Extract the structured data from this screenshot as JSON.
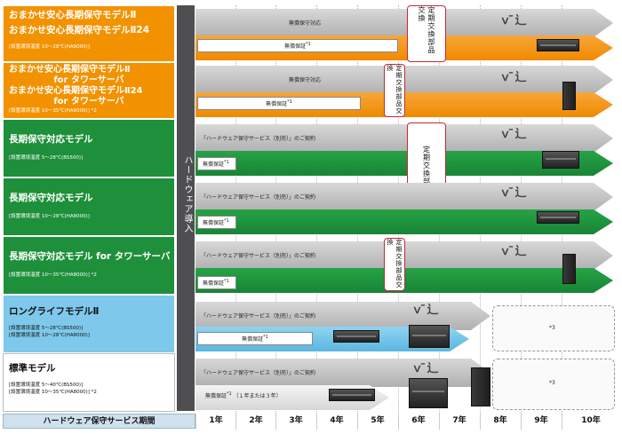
{
  "rows": [
    {
      "title": [
        "おまかせ安心長期保守モデルⅡ",
        "おまかせ安心長期保守モデルⅡ24"
      ],
      "sub": "[設置環境温度 10～28℃(HA8000)]",
      "top_text": "無償保守対応",
      "bottom_text": "無償保証",
      "sup": "*1",
      "end_label": "定期交換部品交換"
    },
    {
      "title": [
        "おまかせ安心長期保守モデルⅡ",
        "for タワーサーバ",
        "おまかせ安心長期保守モデルⅡ24",
        "for タワーサーバ"
      ],
      "sub": "[設置環境温度 10～35℃(HA8000)]",
      "sub_sup": "*2",
      "top_text": "無償保守対応",
      "bottom_text": "無償保証",
      "sup": "*1",
      "end_label": "定期交換部品交換"
    },
    {
      "title": [
        "長期保守対応モデル"
      ],
      "sub": "[設置環境温度 5～28℃(BS500)]",
      "top_text": "「ハードウェア保守サービス（別売）」のご契約",
      "bottom_text": "無償保証",
      "sup": "*1",
      "end_label": "定期交換部品交換"
    },
    {
      "title": [
        "長期保守対応モデル"
      ],
      "sub": "[設置環境温度 10～28℃(HA8000)]",
      "top_text": "「ハードウェア保守サービス（別売）」のご契約",
      "bottom_text": "無償保証",
      "sup": "*1"
    },
    {
      "title": [
        "長期保守対応モデル for タワーサーバ"
      ],
      "sub": "[設置環境温度 10～35℃(HA8000)]",
      "sub_sup": "*2",
      "top_text": "「ハードウェア保守サービス（別売）」のご契約",
      "bottom_text": "無償保証",
      "sup": "*1",
      "end_label": "定期交換部品交換"
    },
    {
      "title": [
        "ロングライフモデルⅡ"
      ],
      "sub": "[設置環境温度 5～28℃(BS500)]",
      "sub2": "[設置環境温度 10～28℃(HA8000)]",
      "top_text": "「ハードウェア保守サービス（別売）」のご契約",
      "bottom_text": "無償保証",
      "sup": "*1",
      "note": "*3"
    },
    {
      "title": [
        "標準モデル"
      ],
      "sub": "[設置環境温度 5～40℃(BS500)]",
      "sub2": "[設置環境温度 10～35℃(HA8000)]",
      "sub_sup": "*2",
      "top_text": "「ハードウェア保守サービス（別売）」のご契約",
      "bottom_text": "無償保証",
      "sup": "*1",
      "bottom_extra": "（１年または３年）",
      "note": "*3"
    }
  ],
  "band_label": "ハードウェア導入",
  "footer": {
    "label": "ハードウェア保守サービス期間",
    "years": [
      "1年",
      "2年",
      "3年",
      "4年",
      "5年",
      "6年",
      "7年",
      "8年",
      "9年",
      "10年"
    ]
  },
  "colors": {
    "orange": "#f39200",
    "green": "#1e8f3a",
    "blue": "#7ec8ec",
    "band": "#4f4f52",
    "end_border": "#c4283b"
  },
  "icons": [
    "server-icon",
    "tower-server-icon",
    "blade-server-icon",
    "mascot-icon"
  ]
}
